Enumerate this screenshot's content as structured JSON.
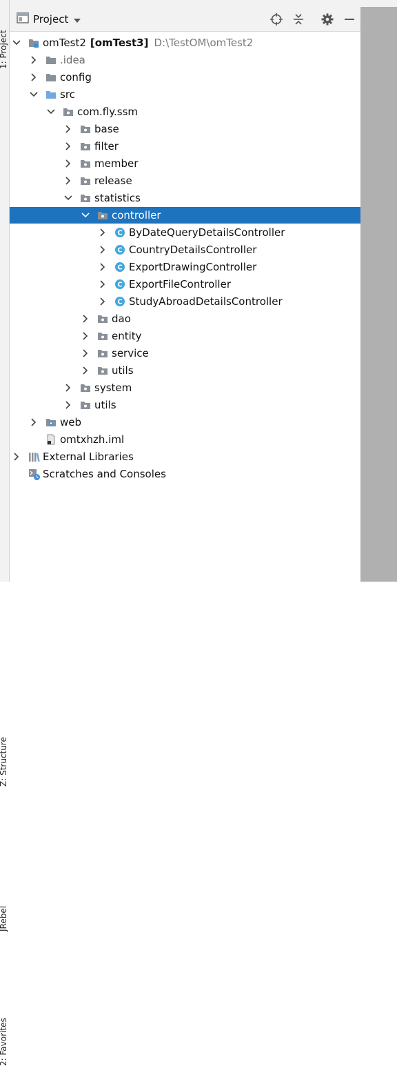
{
  "window": {
    "title": "Project",
    "side_tabs": [
      "1: Project",
      "Z: Structure",
      "JRebel",
      "2: Favorites"
    ]
  },
  "colors": {
    "selection": "#1e73be",
    "folder": "#8a9099",
    "source_folder": "#6fa9e0",
    "class_icon": "#43a7dd"
  },
  "tree": [
    {
      "label": "omTest2",
      "module": "[omTest3]",
      "path": "D:\\TestOM\\omTest2",
      "state": "expanded",
      "icon": "module-folder-icon",
      "depth": 0
    },
    {
      "label": ".idea",
      "state": "collapsed",
      "icon": "folder-icon",
      "depth": 1
    },
    {
      "label": "config",
      "state": "collapsed",
      "icon": "folder-icon",
      "depth": 1
    },
    {
      "label": "src",
      "state": "expanded",
      "icon": "source-folder-icon",
      "depth": 1
    },
    {
      "label": "com.fly.ssm",
      "state": "expanded",
      "icon": "package-icon",
      "depth": 2
    },
    {
      "label": "base",
      "state": "collapsed",
      "icon": "package-icon",
      "depth": 3
    },
    {
      "label": "filter",
      "state": "collapsed",
      "icon": "package-icon",
      "depth": 3
    },
    {
      "label": "member",
      "state": "collapsed",
      "icon": "package-icon",
      "depth": 3
    },
    {
      "label": "release",
      "state": "collapsed",
      "icon": "package-icon",
      "depth": 3
    },
    {
      "label": "statistics",
      "state": "expanded",
      "icon": "package-icon",
      "depth": 3
    },
    {
      "label": "controller",
      "state": "expanded",
      "icon": "package-icon",
      "depth": 4,
      "selected": true
    },
    {
      "label": "ByDateQueryDetailsController",
      "state": "collapsed",
      "icon": "class-icon",
      "depth": 5
    },
    {
      "label": "CountryDetailsController",
      "state": "collapsed",
      "icon": "class-icon",
      "depth": 5
    },
    {
      "label": "ExportDrawingController",
      "state": "collapsed",
      "icon": "class-icon",
      "depth": 5
    },
    {
      "label": "ExportFileController",
      "state": "collapsed",
      "icon": "class-icon",
      "depth": 5
    },
    {
      "label": "StudyAbroadDetailsController",
      "state": "collapsed",
      "icon": "class-icon",
      "depth": 5
    },
    {
      "label": "dao",
      "state": "collapsed",
      "icon": "package-icon",
      "depth": 4
    },
    {
      "label": "entity",
      "state": "collapsed",
      "icon": "package-icon",
      "depth": 4
    },
    {
      "label": "service",
      "state": "collapsed",
      "icon": "package-icon",
      "depth": 4
    },
    {
      "label": "utils",
      "state": "collapsed",
      "icon": "package-icon",
      "depth": 4
    },
    {
      "label": "system",
      "state": "collapsed",
      "icon": "package-icon",
      "depth": 3
    },
    {
      "label": "utils",
      "state": "collapsed",
      "icon": "package-icon",
      "depth": 3
    },
    {
      "label": "web",
      "state": "collapsed",
      "icon": "web-folder-icon",
      "depth": 1
    },
    {
      "label": "omtxhzh.iml",
      "state": "leaf",
      "icon": "file-icon",
      "depth": 1
    },
    {
      "label": "External Libraries",
      "state": "collapsed",
      "icon": "library-icon",
      "depth": 0
    },
    {
      "label": "Scratches and Consoles",
      "state": "leaf",
      "icon": "scratches-icon",
      "depth": 0
    }
  ]
}
